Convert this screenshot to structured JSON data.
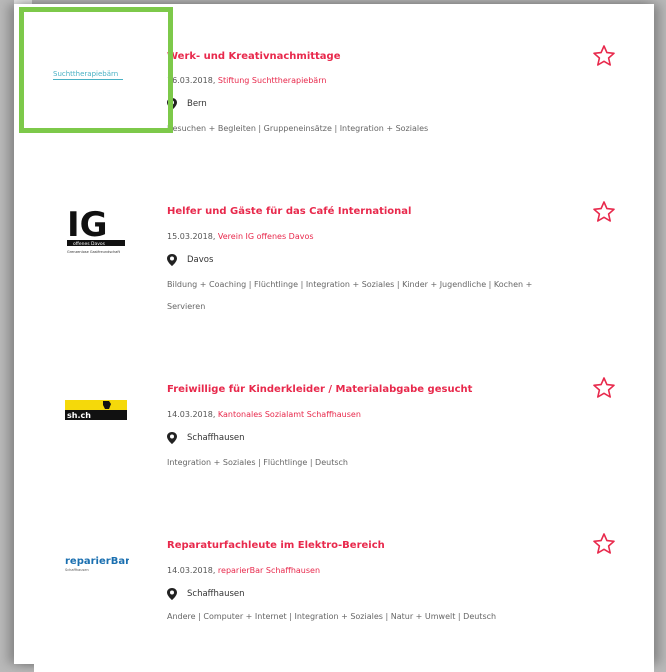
{
  "colors": {
    "accent": "#e8294c",
    "highlight": "#7dc94a",
    "text": "#555555"
  },
  "listings": [
    {
      "logo": {
        "type": "therapiebaern",
        "text": "Suchttherapiebärn"
      },
      "title": "Werk- und Kreativnachmittage",
      "date": "16.03.2018",
      "org": "Stiftung Suchttherapiebärn",
      "location": "Bern",
      "categories": "Besuchen + Begleiten | Gruppeneinsätze | Integration + Soziales",
      "star_icon": "star-outline-icon"
    },
    {
      "logo": {
        "type": "ig",
        "text": "IG",
        "sub1": "offenes Davos",
        "sub2": "Grenzenlose Gastfreundschaft"
      },
      "title": "Helfer und Gäste für das Café International",
      "date": "15.03.2018",
      "org": "Verein IG offenes Davos",
      "location": "Davos",
      "categories": "Bildung + Coaching | Flüchtlinge | Integration + Soziales | Kinder + Jugendliche | Kochen + Servieren",
      "star_icon": "star-outline-icon"
    },
    {
      "logo": {
        "type": "shch",
        "text": "sh.ch"
      },
      "title": "Freiwillige für Kinderkleider / Materialabgabe gesucht",
      "date": "14.03.2018",
      "org": "Kantonales Sozialamt Schaffhausen",
      "location": "Schaffhausen",
      "categories": "Integration + Soziales | Flüchtlinge | Deutsch",
      "star_icon": "star-outline-icon"
    },
    {
      "logo": {
        "type": "reparierbar",
        "text": "reparierBar",
        "sub": "Schaffhausen"
      },
      "title": "Reparaturfachleute im Elektro-Bereich",
      "date": "14.03.2018",
      "org": "reparierBar Schaffhausen",
      "location": "Schaffhausen",
      "categories": "Andere | Computer + Internet | Integration + Soziales | Natur + Umwelt | Deutsch",
      "star_icon": "star-outline-icon"
    }
  ]
}
